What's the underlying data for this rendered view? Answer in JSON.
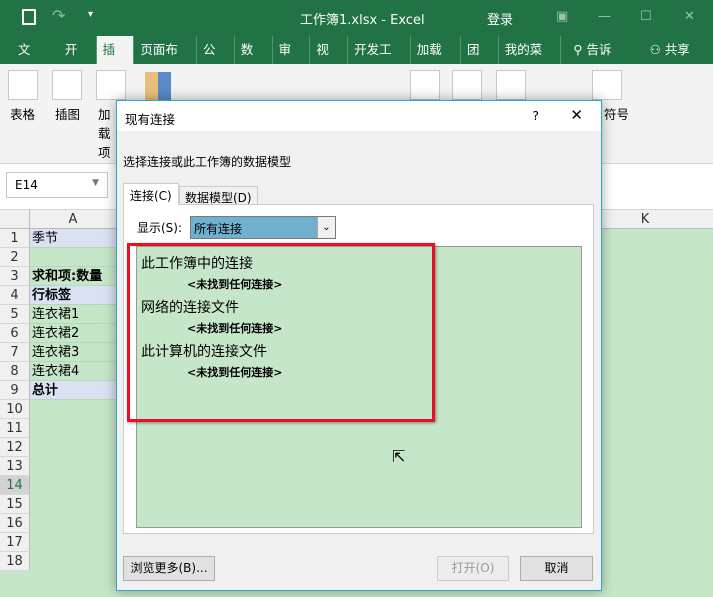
{
  "window": {
    "title": "工作簿1.xlsx  -  Excel",
    "login": "登录"
  },
  "tabs": [
    "文件",
    "开始",
    "插入",
    "页面布局",
    "公式",
    "数据",
    "审阅",
    "视图",
    "开发工具",
    "加载项",
    "团队",
    "我的菜单"
  ],
  "active_tab": "插入",
  "tell_me": "告诉我",
  "share": "共享(S)",
  "ribbon": {
    "table": "表格",
    "illustrations": "插图",
    "addins": "加载项",
    "symbols": "符号"
  },
  "name_box": "E14",
  "columns": [
    "A",
    "K"
  ],
  "rows": [
    "1",
    "2",
    "3",
    "4",
    "5",
    "6",
    "7",
    "8",
    "9",
    "10",
    "11",
    "12",
    "13",
    "14",
    "15",
    "16",
    "17",
    "18"
  ],
  "cells": [
    "季节",
    "",
    "求和项:数量",
    "行标签",
    "连衣裙1",
    "连衣裙2",
    "连衣裙3",
    "连衣裙4",
    "总计"
  ],
  "dialog": {
    "title": "现有连接",
    "help": "?",
    "subtitle": "选择连接或此工作簿的数据模型",
    "tabs": [
      "连接(C)",
      "数据模型(D)"
    ],
    "show_label": "显示(S):",
    "show_value": "所有连接",
    "sections": [
      {
        "title": "此工作簿中的连接",
        "empty": "<未找到任何连接>"
      },
      {
        "title": "网络的连接文件",
        "empty": "<未找到任何连接>"
      },
      {
        "title": "此计算机的连接文件",
        "empty": "<未找到任何连接>"
      }
    ],
    "browse": "浏览更多(B)...",
    "open": "打开(O)",
    "cancel": "取消"
  }
}
